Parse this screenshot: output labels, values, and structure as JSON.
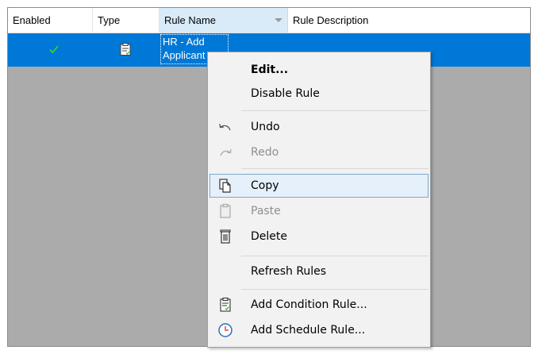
{
  "grid": {
    "columns": [
      {
        "key": "enabled",
        "label": "Enabled"
      },
      {
        "key": "type",
        "label": "Type"
      },
      {
        "key": "rule_name",
        "label": "Rule Name"
      },
      {
        "key": "rule_description",
        "label": "Rule Description"
      }
    ],
    "sorted_column": "rule_name",
    "rows": [
      {
        "enabled": true,
        "type_icon": "clipboard-icon",
        "rule_name": "HR - Add Applicant to Datab",
        "rule_description": ""
      }
    ]
  },
  "context_menu": {
    "items": [
      {
        "label": "Edit...",
        "icon": "",
        "bold": true,
        "disabled": false
      },
      {
        "label": "Disable Rule",
        "icon": "",
        "bold": false,
        "disabled": false
      },
      {
        "label": "Undo",
        "icon": "undo-icon",
        "bold": false,
        "disabled": false
      },
      {
        "label": "Redo",
        "icon": "redo-icon",
        "bold": false,
        "disabled": true
      },
      {
        "label": "Copy",
        "icon": "copy-icon",
        "bold": false,
        "disabled": false,
        "highlighted": true
      },
      {
        "label": "Paste",
        "icon": "paste-icon",
        "bold": false,
        "disabled": true
      },
      {
        "label": "Delete",
        "icon": "trash-icon",
        "bold": false,
        "disabled": false
      },
      {
        "label": "Refresh Rules",
        "icon": "",
        "bold": false,
        "disabled": false
      },
      {
        "label": "Add Condition Rule...",
        "icon": "condition-rule-icon",
        "bold": false,
        "disabled": false
      },
      {
        "label": "Add Schedule Rule...",
        "icon": "clock-icon",
        "bold": false,
        "disabled": false
      }
    ]
  },
  "colors": {
    "selection": "#0078d7",
    "empty_area": "#ababab",
    "menu_bg": "#f2f2f2",
    "check": "#3cc43c",
    "clock": "#2a6ebd",
    "sorted_header": "#d9ebf9"
  }
}
